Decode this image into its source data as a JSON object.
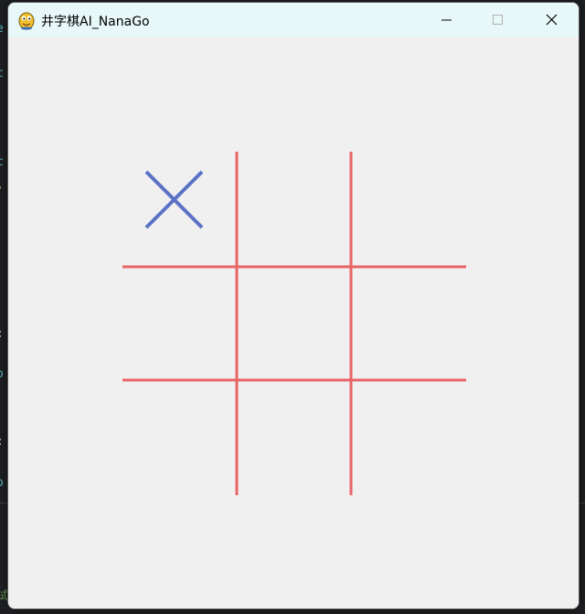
{
  "window": {
    "title": "井字棋AI_NanaGo",
    "app_icon": "pygame-snake-icon",
    "controls": {
      "minimize_icon": "minimize-icon",
      "maximize_icon": "maximize-icon",
      "close_icon": "close-icon"
    }
  },
  "background_fragments": [
    "e",
    "c",
    "c",
    ",",
    ":",
    "o",
    ":",
    "o",
    "试"
  ],
  "board": {
    "grid_color": "#e86566",
    "x_color": "#5a72c6",
    "cells": [
      "X",
      "",
      "",
      "",
      "",
      "",
      "",
      "",
      ""
    ]
  }
}
